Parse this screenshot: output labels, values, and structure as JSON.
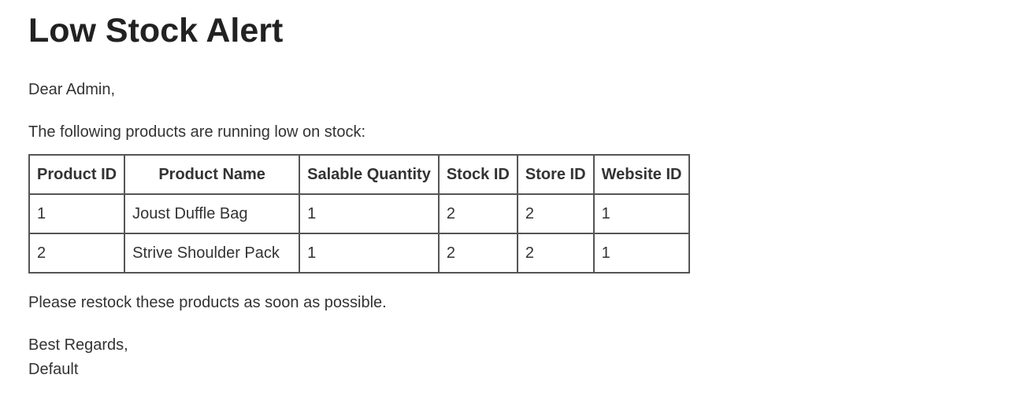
{
  "email": {
    "title": "Low Stock Alert",
    "greeting": "Dear Admin,",
    "intro": "The following products are running low on stock:",
    "closing": "Please restock these products as soon as possible.",
    "regards": "Best Regards,",
    "signature": "Default"
  },
  "table": {
    "headers": [
      "Product ID",
      "Product Name",
      "Salable Quantity",
      "Stock ID",
      "Store ID",
      "Website ID"
    ],
    "rows": [
      [
        "1",
        "Joust Duffle Bag",
        "1",
        "2",
        "2",
        "1"
      ],
      [
        "2",
        "Strive Shoulder Pack",
        "1",
        "2",
        "2",
        "1"
      ]
    ]
  }
}
